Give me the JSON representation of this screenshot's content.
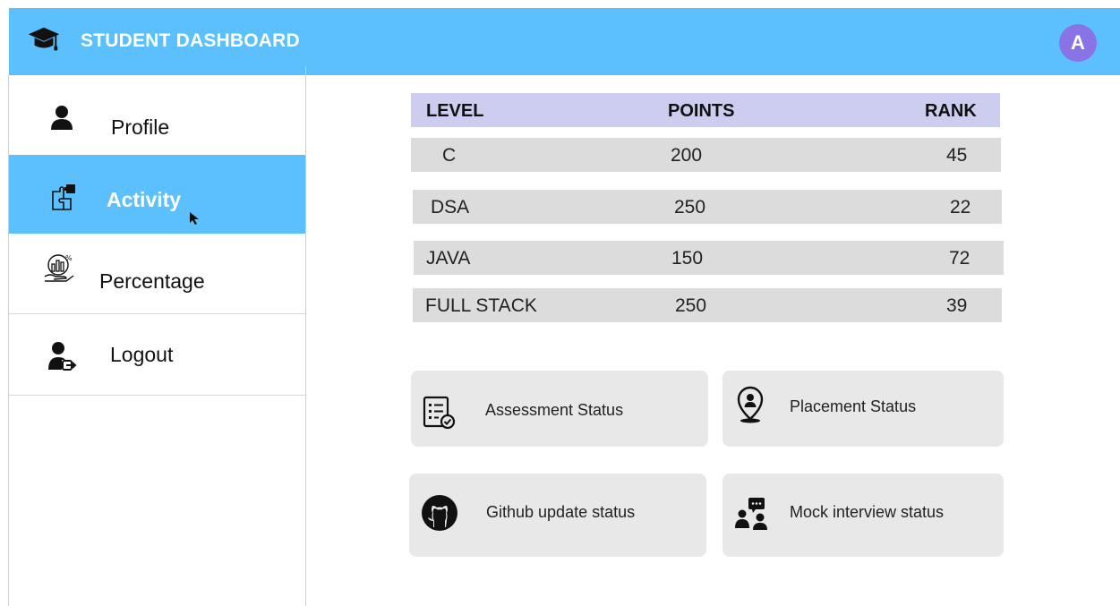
{
  "header": {
    "title": "STUDENT DASHBOARD",
    "avatar_letter": "A",
    "logo_icon": "graduation-cap-icon",
    "bg_color": "#5cc0ff",
    "avatar_color": "#8a73e4"
  },
  "sidebar": {
    "active_color": "#5cc0ff",
    "items": [
      {
        "label": "Profile",
        "icon": "user-icon",
        "active": false
      },
      {
        "label": "Activity",
        "icon": "puzzle-icon",
        "active": true
      },
      {
        "label": "Percentage",
        "icon": "chart-hand-icon",
        "active": false
      },
      {
        "label": "Logout",
        "icon": "user-logout-icon",
        "active": false
      }
    ]
  },
  "table": {
    "header_color": "#cdcdf0",
    "row_color": "#dcdcdc",
    "columns": [
      "LEVEL",
      "POINTS",
      "RANK"
    ],
    "rows": [
      {
        "level": "C",
        "points": "200",
        "rank": "45"
      },
      {
        "level": "DSA",
        "points": "250",
        "rank": "22"
      },
      {
        "level": "JAVA",
        "points": "150",
        "rank": "72"
      },
      {
        "level": "FULL STACK",
        "points": "250",
        "rank": "39"
      }
    ]
  },
  "cards": {
    "bg_color": "#e8e8e8",
    "items": [
      {
        "label": "Assessment Status",
        "icon": "checklist-icon"
      },
      {
        "label": "Placement Status",
        "icon": "location-person-icon"
      },
      {
        "label": "Github update status",
        "icon": "github-icon"
      },
      {
        "label": "Mock interview status",
        "icon": "interview-chat-icon"
      }
    ]
  }
}
